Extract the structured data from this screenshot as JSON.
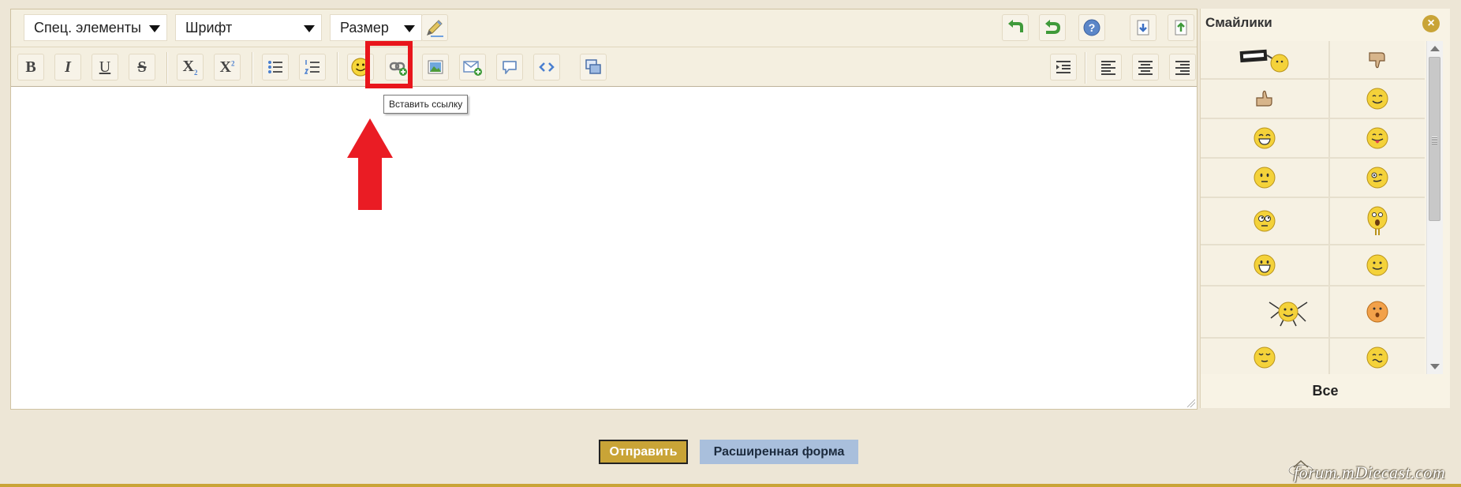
{
  "toolbar": {
    "dropdowns": {
      "special": "Спец. элементы",
      "font": "Шрифт",
      "size": "Размер"
    },
    "format_letters": {
      "bold": "B",
      "italic": "I",
      "underline": "U",
      "strike": "S",
      "subscript": "X",
      "subscript_mark": "2",
      "superscript": "X",
      "superscript_mark": "2"
    }
  },
  "tooltip": "Вставить ссылку",
  "smileys_panel": {
    "title": "Смайлики",
    "all_label": "Все"
  },
  "buttons": {
    "send": "Отправить",
    "advanced": "Расширенная форма"
  },
  "watermark": "forum.mDiecast.com",
  "colors": {
    "accent": "#c9a437",
    "highlight": "#e8151b",
    "background": "#ede6d6",
    "advanced_button": "#a9bfdc"
  }
}
